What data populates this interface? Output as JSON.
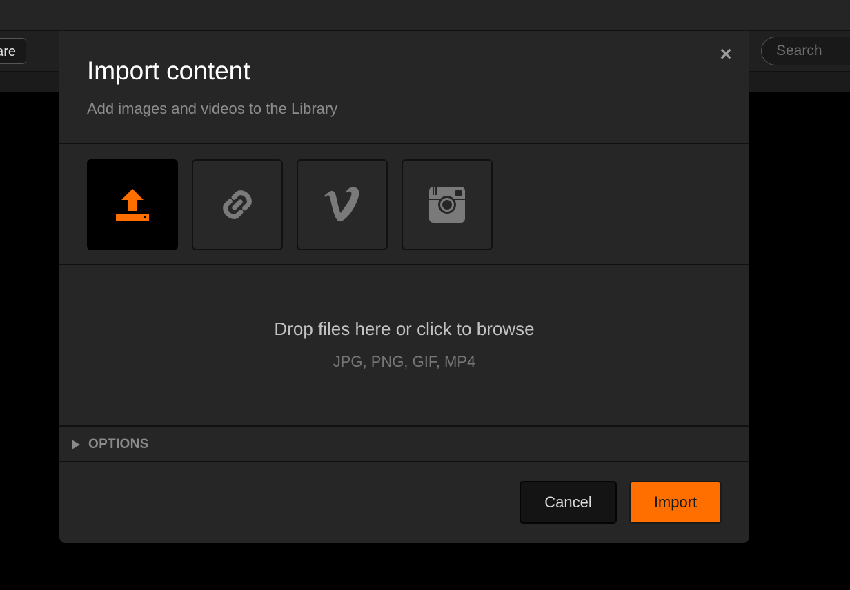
{
  "background": {
    "share_button_label": "are",
    "search_placeholder": "Search",
    "chevron_glyph": "›"
  },
  "modal": {
    "title": "Import content",
    "subtitle": "Add images and videos to the Library",
    "close_glyph": "×",
    "sources": [
      {
        "name": "upload",
        "icon": "upload-icon",
        "active": true
      },
      {
        "name": "link",
        "icon": "link-icon",
        "active": false
      },
      {
        "name": "vimeo",
        "icon": "vimeo-icon",
        "active": false
      },
      {
        "name": "instagram",
        "icon": "instagram-icon",
        "active": false
      }
    ],
    "dropzone": {
      "text": "Drop files here or click to browse",
      "formats": "JPG, PNG, GIF, MP4"
    },
    "options_label": "OPTIONS",
    "cancel_label": "Cancel",
    "import_label": "Import"
  },
  "colors": {
    "accent": "#ff6f00",
    "modal_bg": "#262626",
    "icon_gray": "#7a7a7a"
  }
}
